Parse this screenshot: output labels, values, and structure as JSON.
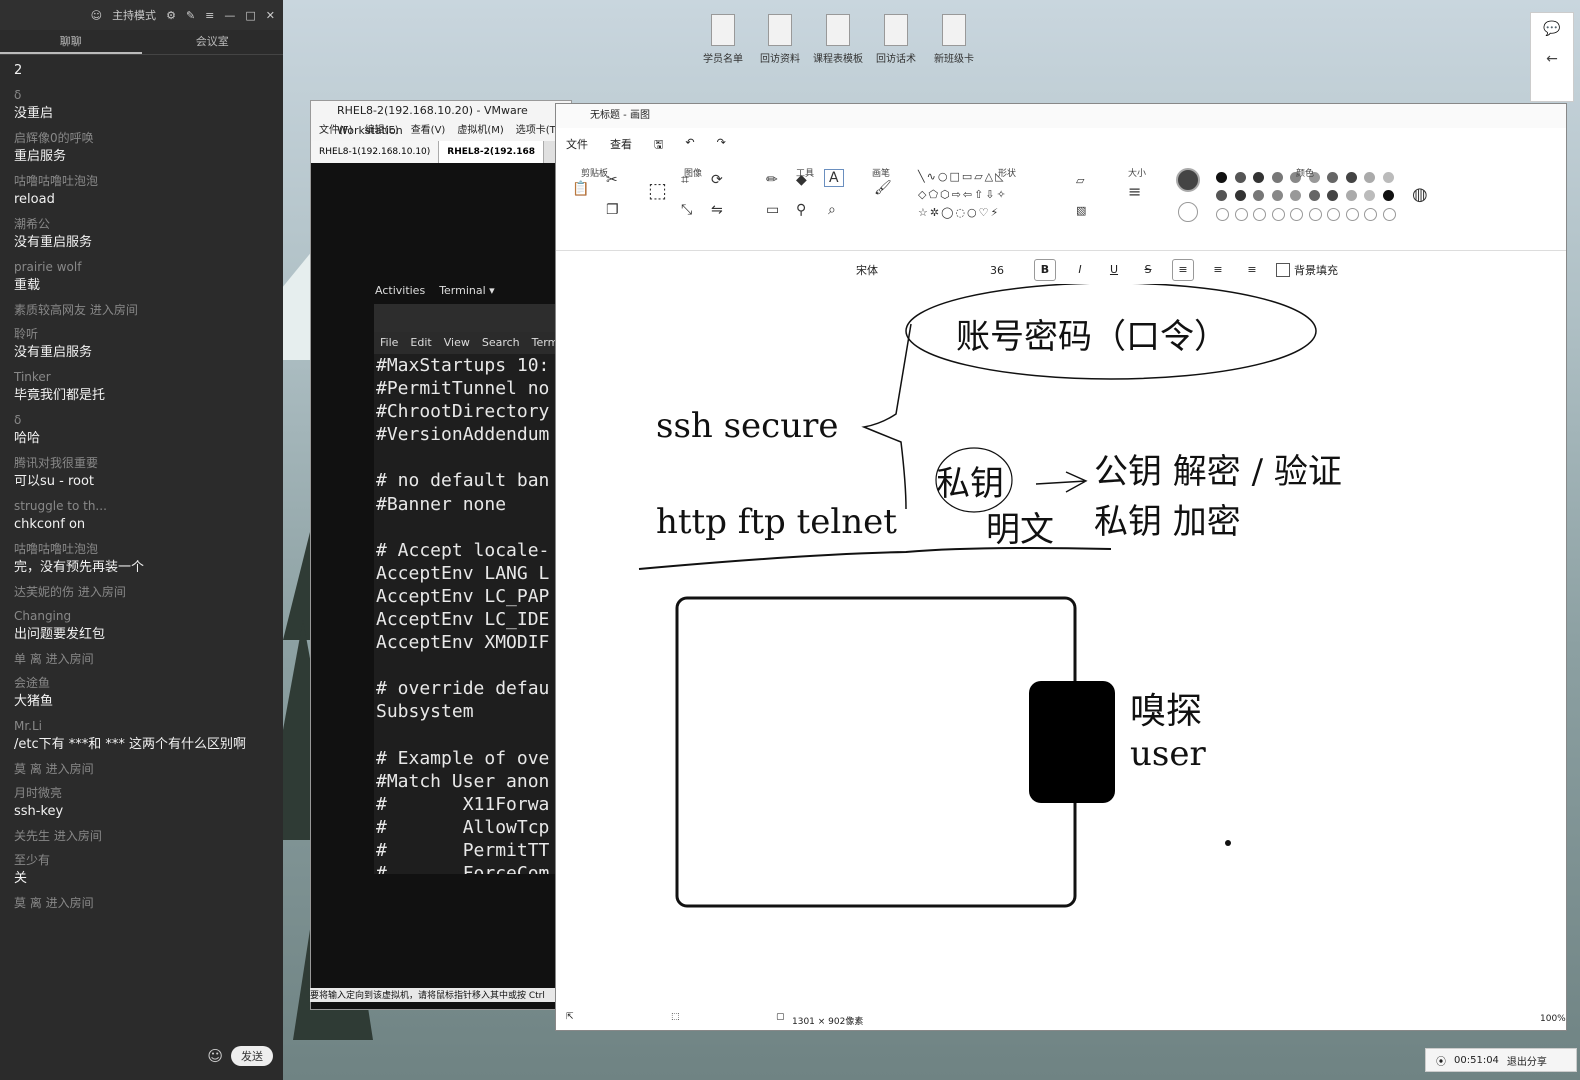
{
  "chat": {
    "mode_label": "主持模式",
    "tabs": [
      "聊聊",
      "会议室"
    ],
    "messages": [
      {
        "name": "",
        "text": "2"
      },
      {
        "name": "δ",
        "text": "没重启"
      },
      {
        "name": "启辉像0的呼唤",
        "text": "重启服务"
      },
      {
        "name": "咕噜咕噜吐泡泡",
        "text": "reload"
      },
      {
        "name": "潮希公",
        "text": "没有重启服务"
      },
      {
        "name": "prairie wolf",
        "text": "重载"
      },
      {
        "name": "素质较高网友 进入房间",
        "text": ""
      },
      {
        "name": "聆听",
        "text": "没有重启服务"
      },
      {
        "name": "Tinker",
        "text": "毕竟我们都是托"
      },
      {
        "name": "δ",
        "text": "哈哈"
      },
      {
        "name": "腾讯对我很重要",
        "text": "可以su - root"
      },
      {
        "name": "struggle to th...",
        "text": "chkconf on"
      },
      {
        "name": "咕噜咕噜吐泡泡",
        "text": "完，没有预先再装一个"
      },
      {
        "name": "达芙妮的伤 进入房间",
        "text": ""
      },
      {
        "name": "Changing",
        "text": "出问题要发红包"
      },
      {
        "name": "单 离 进入房间",
        "text": ""
      },
      {
        "name": "会途鱼",
        "text": "大猪鱼"
      },
      {
        "name": "Mr.Li",
        "text": "/etc下有 ***和 *** 这两个有什么区别啊"
      },
      {
        "name": "莫 离 进入房间",
        "text": ""
      },
      {
        "name": "月时微亮",
        "text": "ssh-key"
      },
      {
        "name": "关先生 进入房间",
        "text": ""
      },
      {
        "name": "至少有",
        "text": "关"
      },
      {
        "name": "莫 离 进入房间",
        "text": ""
      }
    ],
    "send_label": "发送"
  },
  "desktop_icons": [
    "学员名单",
    "回访资料",
    "课程表模板",
    "回访话术",
    "新班级卡"
  ],
  "vmware": {
    "title": "RHEL8-2(192.168.10.20) - VMware Workstation",
    "menu": [
      "文件(F)",
      "编辑(E)",
      "查看(V)",
      "虚拟机(M)",
      "选项卡(T)"
    ],
    "tabs": [
      "RHEL8-1(192.168.10.10)",
      "RHEL8-2(192.168"
    ],
    "status": "要将输入定向到该虚拟机，请将鼠标指针移入其中或按 Ctrl"
  },
  "gnome": {
    "activities": "Activities",
    "terminal": "Terminal ▾"
  },
  "terminal": {
    "menu": [
      "File",
      "Edit",
      "View",
      "Search",
      "Termi"
    ],
    "lines": [
      "#MaxStartups 10:",
      "#PermitTunnel no",
      "#ChrootDirectory",
      "#VersionAddendum",
      "",
      "# no default ban",
      "#Banner none",
      "",
      "# Accept locale-",
      "AcceptEnv LANG L",
      "AcceptEnv LC_PAP",
      "AcceptEnv LC_IDE",
      "AcceptEnv XMODIF",
      "",
      "# override defau",
      "Subsystem",
      "",
      "# Example of ove",
      "#Match User anon",
      "#       X11Forwa",
      "#       AllowTcp",
      "#       PermitTT",
      "#       ForceCom"
    ]
  },
  "paint": {
    "title": "无标题 - 画图",
    "menu": [
      "文件",
      "查看"
    ],
    "groups": [
      "剪贴板",
      "图像",
      "工具",
      "画笔",
      "形状",
      "大小",
      "颜色"
    ],
    "font_name": "宋体",
    "font_size": "36",
    "bg_fill_label": "背景填充",
    "canvas_size": "1301 × 902像素",
    "zoom": "100%",
    "handwriting": {
      "bubble": "账号密码（口令）",
      "ssh": "ssh  secure",
      "private_key": "私钥",
      "plain": "http  ftp  telnet",
      "plaintext_label": "明文",
      "pub_line": "公钥  解密  /  验证",
      "priv_line": "私钥  加密",
      "sniff": "嗅探",
      "user": "user"
    },
    "palette": [
      "#111111",
      "#555555",
      "#333333",
      "#777777",
      "#888888",
      "#999999",
      "#666666",
      "#444444",
      "#aaaaaa",
      "#bbbbbb"
    ]
  },
  "timer": {
    "time": "00:51:04",
    "exit_label": "退出分享"
  }
}
